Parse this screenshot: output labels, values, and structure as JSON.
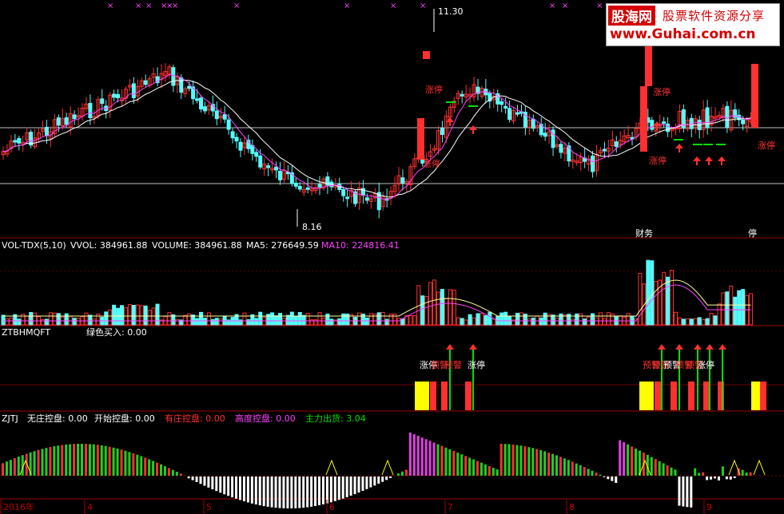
{
  "watermark": {
    "logo": "股海网",
    "subtitle": "股票软件资源分享",
    "url": "www.Guhai.com.cn"
  },
  "chart_data": [
    {
      "type": "candlestick",
      "panel": "price",
      "annotations": {
        "high_label": "11.30",
        "low_label": "8.16",
        "limit_up_labels": [
          "涨停",
          "涨停",
          "涨停",
          "涨停",
          "涨停"
        ],
        "events": [
          "财务",
          "停"
        ]
      },
      "ma_lines": [
        "white",
        "magenta"
      ],
      "signal_arrows": 7,
      "colors": {
        "up": "#ff3030",
        "down": "#54fcfc",
        "ma5": "#ffffff",
        "ma10": "#ff40ff"
      }
    },
    {
      "type": "bar",
      "panel": "volume",
      "indicator": "VOL-TDX(5,10)",
      "labels": {
        "vvol": "VVOL: 384961.88",
        "volume": "VOLUME: 384961.88",
        "ma5": "MA5: 276649.59",
        "ma10": "MA10: 224816.41"
      }
    },
    {
      "type": "bar",
      "panel": "signal",
      "indicator": "ZTBHMQFT",
      "labels": {
        "green_buy": "绿色买入: 0.00"
      },
      "signal_texts": [
        "涨停",
        "预警",
        "预警",
        "涨停",
        "预警",
        "预警",
        "预警",
        "预警",
        "预警",
        "涨停"
      ]
    },
    {
      "type": "bar",
      "panel": "control",
      "indicator": "ZJTJ",
      "labels": {
        "no_control": "无庄控盘: 0.00",
        "start_control": "开始控盘: 0.00",
        "has_control": "有庄控盘: 0.00",
        "high_control": "高度控盘: 0.00",
        "main_selling": "主力出货: 3.04"
      }
    }
  ],
  "x_axis": {
    "labels": [
      "2016年",
      "4",
      "5",
      "6",
      "7",
      "8",
      "9"
    ]
  }
}
